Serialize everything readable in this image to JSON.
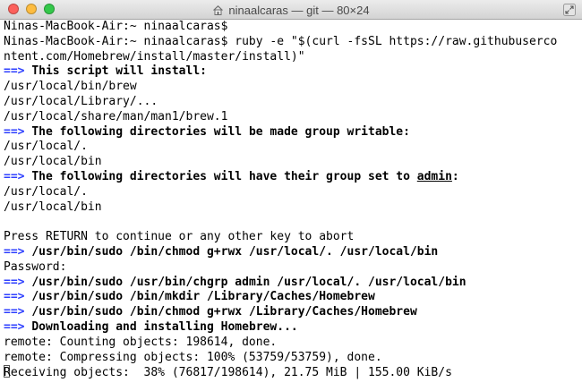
{
  "window": {
    "title": "ninaalcaras — git — 80×24",
    "colors": {
      "close": "#fc605b",
      "minimize": "#fdbc40",
      "zoom": "#34c84a",
      "arrow": "#2d3fff"
    }
  },
  "terminal": {
    "arrow_glyph": "==>",
    "lines": [
      {
        "type": "plain",
        "text": "Ninas-MacBook-Air:~ ninaalcaras$"
      },
      {
        "type": "plain",
        "text": "Ninas-MacBook-Air:~ ninaalcaras$ ruby -e \"$(curl -fsSL https://raw.githubuserco"
      },
      {
        "type": "plain",
        "text": "ntent.com/Homebrew/install/master/install)\""
      },
      {
        "type": "arrow",
        "text": "This script will install:"
      },
      {
        "type": "plain",
        "text": "/usr/local/bin/brew"
      },
      {
        "type": "plain",
        "text": "/usr/local/Library/..."
      },
      {
        "type": "plain",
        "text": "/usr/local/share/man/man1/brew.1"
      },
      {
        "type": "arrow",
        "text": "The following directories will be made group writable:"
      },
      {
        "type": "plain",
        "text": "/usr/local/."
      },
      {
        "type": "plain",
        "text": "/usr/local/bin"
      },
      {
        "type": "arrow_underline",
        "before": "The following directories will have their group set to ",
        "underline": "admin",
        "after": ":"
      },
      {
        "type": "plain",
        "text": "/usr/local/."
      },
      {
        "type": "plain",
        "text": "/usr/local/bin"
      },
      {
        "type": "plain",
        "text": ""
      },
      {
        "type": "plain",
        "text": "Press RETURN to continue or any other key to abort"
      },
      {
        "type": "arrow",
        "text": "/usr/bin/sudo /bin/chmod g+rwx /usr/local/. /usr/local/bin"
      },
      {
        "type": "plain",
        "text": "Password:"
      },
      {
        "type": "arrow",
        "text": "/usr/bin/sudo /usr/bin/chgrp admin /usr/local/. /usr/local/bin"
      },
      {
        "type": "arrow",
        "text": "/usr/bin/sudo /bin/mkdir /Library/Caches/Homebrew"
      },
      {
        "type": "arrow",
        "text": "/usr/bin/sudo /bin/chmod g+rwx /Library/Caches/Homebrew"
      },
      {
        "type": "arrow",
        "text": "Downloading and installing Homebrew..."
      },
      {
        "type": "plain",
        "text": "remote: Counting objects: 198614, done."
      },
      {
        "type": "plain",
        "text": "remote: Compressing objects: 100% (53759/53759), done."
      },
      {
        "type": "cursor",
        "text": "Receiving objects:  38% (76817/198614), 21.75 MiB | 155.00 KiB/s"
      }
    ]
  }
}
